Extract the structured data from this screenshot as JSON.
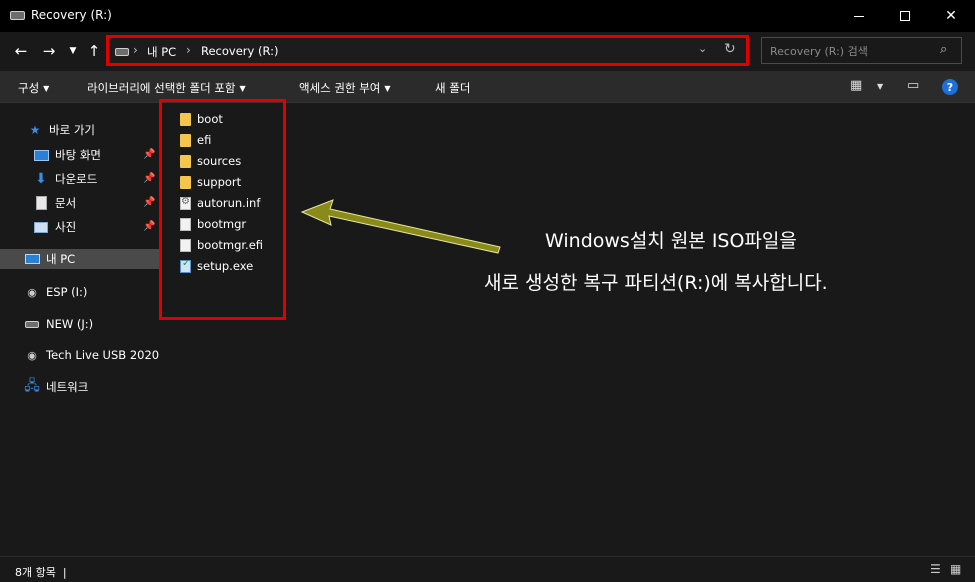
{
  "window": {
    "title": "Recovery (R:)"
  },
  "address": {
    "crumbs": [
      "내 PC",
      "Recovery (R:)"
    ]
  },
  "search": {
    "placeholder": "Recovery (R:) 검색"
  },
  "toolbar": {
    "organize": "구성",
    "include_library": "라이브러리에 선택한 폴더 포함",
    "access_grant": "액세스 권한 부여",
    "new_folder": "새 폴더"
  },
  "sidebar": {
    "quick_access": "바로 가기",
    "items": [
      {
        "label": "바탕 화면",
        "icon": "desktop-icon",
        "pinned": true
      },
      {
        "label": "다운로드",
        "icon": "download-icon",
        "pinned": true
      },
      {
        "label": "문서",
        "icon": "document-icon",
        "pinned": true
      },
      {
        "label": "사진",
        "icon": "picture-icon",
        "pinned": true
      }
    ],
    "this_pc": "내 PC",
    "drives": [
      "ESP (I:)",
      "NEW (J:)",
      "Tech Live USB 2020"
    ],
    "network": "네트워크"
  },
  "files": [
    {
      "name": "boot",
      "icon": "folder-icon"
    },
    {
      "name": "efi",
      "icon": "folder-icon"
    },
    {
      "name": "sources",
      "icon": "folder-icon"
    },
    {
      "name": "support",
      "icon": "folder-icon"
    },
    {
      "name": "autorun.inf",
      "icon": "settings-file-icon"
    },
    {
      "name": "bootmgr",
      "icon": "file-icon"
    },
    {
      "name": "bootmgr.efi",
      "icon": "file-icon"
    },
    {
      "name": "setup.exe",
      "icon": "setup-icon"
    }
  ],
  "annotation": {
    "line1": "Windows설치 원본 ISO파일을",
    "line2": "새로 생성한 복구 파티션(R:)에 복사합니다.",
    "arrow_color": "#8a8a1a",
    "box_color": "#e00000"
  },
  "status": {
    "item_count": "8개 항목"
  }
}
